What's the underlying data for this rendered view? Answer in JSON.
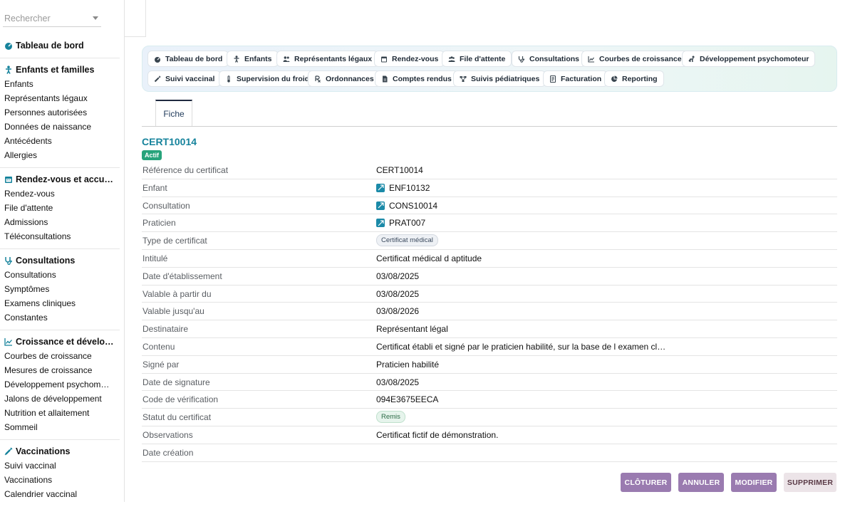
{
  "search": {
    "placeholder": "Rechercher"
  },
  "sidebar": {
    "home_label": "Tableau de bord",
    "groups": [
      {
        "title": "Enfants et familles",
        "items": [
          "Enfants",
          "Représentants légaux",
          "Personnes autorisées",
          "Données de naissance",
          "Antécédents",
          "Allergies"
        ]
      },
      {
        "title": "Rendez-vous et accu…",
        "items": [
          "Rendez-vous",
          "File d'attente",
          "Admissions",
          "Téléconsultations"
        ]
      },
      {
        "title": "Consultations",
        "items": [
          "Consultations",
          "Symptômes",
          "Examens cliniques",
          "Constantes"
        ]
      },
      {
        "title": "Croissance et dévelo…",
        "items": [
          "Courbes de croissance",
          "Mesures de croissance",
          "Développement psychom…",
          "Jalons de développement",
          "Nutrition et allaitement",
          "Sommeil"
        ]
      },
      {
        "title": "Vaccinations",
        "items": [
          "Suivi vaccinal",
          "Vaccinations",
          "Calendrier vaccinal"
        ]
      }
    ]
  },
  "nav": {
    "row1": [
      "Tableau de bord",
      "Enfants",
      "Représentants légaux",
      "Rendez-vous",
      "File d'attente",
      "Consultations",
      "Courbes de croissance",
      "Développement psychomoteur"
    ],
    "row2": [
      "Suivi vaccinal",
      "Supervision du froid",
      "Ordonnances",
      "Comptes rendus",
      "Suivis pédiatriques",
      "Facturation",
      "Reporting"
    ]
  },
  "tabs": {
    "fiche": "Fiche"
  },
  "record": {
    "title": "CERT10014",
    "status": "Actif",
    "fields": [
      {
        "label": "Référence du certificat",
        "value": "CERT10014"
      },
      {
        "label": "Enfant",
        "value": "ENF10132"
      },
      {
        "label": "Consultation",
        "value": "CONS10014"
      },
      {
        "label": "Praticien",
        "value": "PRAT007"
      },
      {
        "label": "Type de certificat",
        "value": "Certificat médical"
      },
      {
        "label": "Intitulé",
        "value": "Certificat médical d aptitude"
      },
      {
        "label": "Date d'établissement",
        "value": "03/08/2025"
      },
      {
        "label": "Valable à partir du",
        "value": "03/08/2025"
      },
      {
        "label": "Valable jusqu'au",
        "value": "03/08/2026"
      },
      {
        "label": "Destinataire",
        "value": "Représentant légal"
      },
      {
        "label": "Contenu",
        "value": "Certificat établi et signé par le praticien habilité, sur la base de l examen cl…"
      },
      {
        "label": "Signé par",
        "value": "Praticien habilité"
      },
      {
        "label": "Date de signature",
        "value": "03/08/2025"
      },
      {
        "label": "Code de vérification",
        "value": "094E3675EECA"
      },
      {
        "label": "Statut du certificat",
        "value": "Remis"
      },
      {
        "label": "Observations",
        "value": "Certificat fictif de démonstration."
      },
      {
        "label": "Date création",
        "value": ""
      }
    ]
  },
  "actions": {
    "close": "CLÔTURER",
    "cancel": "ANNULER",
    "edit": "MODIFIER",
    "delete": "SUPPRIMER"
  },
  "colors": {
    "accent": "#16839c",
    "active_badge": "#27a37b",
    "action_button": "#9a7bb0"
  }
}
